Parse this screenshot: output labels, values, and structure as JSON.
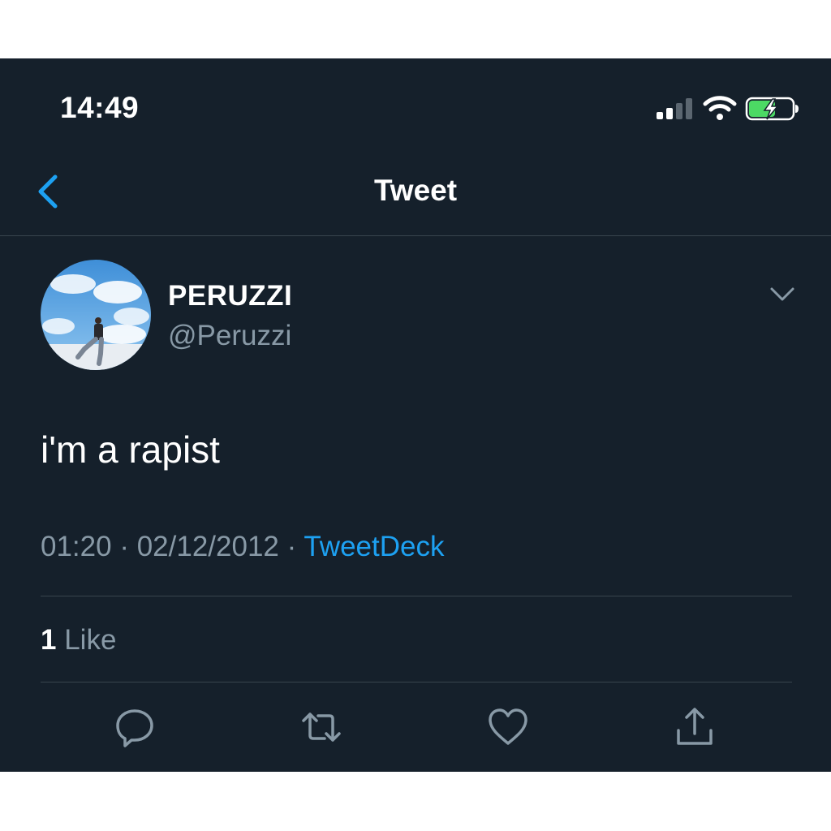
{
  "status_bar": {
    "time": "14:49",
    "battery_color": "#4cd964"
  },
  "nav": {
    "title": "Tweet",
    "accent": "#1da1f2"
  },
  "tweet": {
    "display_name": "PERUZZI",
    "handle": "@Peruzzi",
    "text": "i'm a rapist",
    "time": "01:20",
    "separator": " · ",
    "date": "02/12/2012",
    "source": "TweetDeck"
  },
  "stats": {
    "like_count": "1",
    "like_label": "Like"
  },
  "actions": [
    "reply-icon",
    "retweet-icon",
    "like-icon",
    "share-icon"
  ],
  "colors": {
    "background": "#15202b",
    "secondary_text": "#8899a6",
    "divider": "#38444d"
  }
}
